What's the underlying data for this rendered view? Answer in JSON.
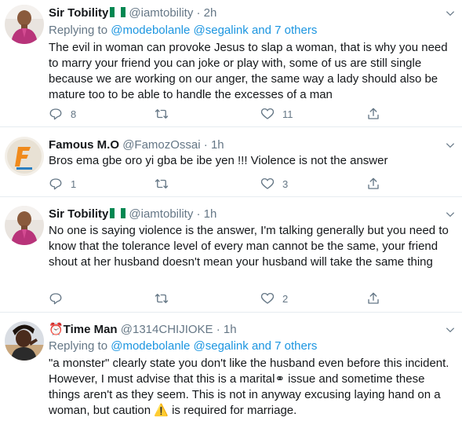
{
  "tweets": [
    {
      "name": "Sir Tobility",
      "handle": "@iamtobility",
      "dot": "·",
      "time": "2h",
      "replying_prefix": "Replying to",
      "replying_mentions": "@modebolanle @segalink and 7 others",
      "text": "The evil in woman can provoke Jesus to slap a woman, that is why you need to marry your friend you can joke or play with, some of us are still single because we are working on our anger, the same way a lady should also be mature too to be able to handle the excesses of a man",
      "replies": "8",
      "retweets": "",
      "likes": "11"
    },
    {
      "name": "Famous M.O",
      "handle": "@FamozOssai",
      "dot": "·",
      "time": "1h",
      "text": "Bros ema gbe oro yi gba be ibe yen !!! Violence is not the answer",
      "replies": "1",
      "retweets": "",
      "likes": "3"
    },
    {
      "name": "Sir Tobility",
      "handle": "@iamtobility",
      "dot": "·",
      "time": "1h",
      "text": "No one is saying violence is the answer, I'm talking generally but you need to know that the tolerance level of every man cannot be the same, your friend shout at her husband doesn't mean your husband will take the same thing",
      "replies": "",
      "retweets": "",
      "likes": "2"
    },
    {
      "name": "⏰Time Man",
      "handle": "@1314CHIJIOKE",
      "dot": "·",
      "time": "1h",
      "replying_prefix": "Replying to",
      "replying_mentions": "@modebolanle @segalink and 7 others",
      "text": "\"a monster\" clearly state you don't like the husband even before this incident. However, I must advise that this is a marital⚭ issue and sometime these things aren't as they seem. This is not in anyway excusing laying hand on a woman, but caution ⚠️ is required for marriage."
    }
  ],
  "colors": {
    "text": "#14171a",
    "secondary": "#657786",
    "link": "#1b95e0",
    "border": "#e6ecf0"
  },
  "icons": [
    "reply-icon",
    "retweet-icon",
    "like-icon",
    "share-icon",
    "caret-down-icon",
    "nigeria-flag-icon"
  ]
}
